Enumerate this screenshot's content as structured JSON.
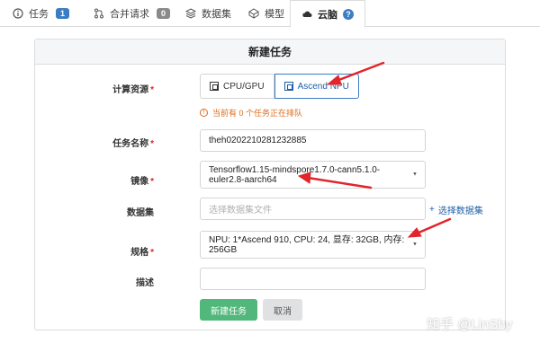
{
  "tabs": [
    {
      "label": "任务",
      "badge": "1",
      "icon": "info-icon"
    },
    {
      "label": "合并请求",
      "badge": "0",
      "icon": "merge-icon"
    },
    {
      "label": "数据集",
      "icon": "dataset-icon"
    },
    {
      "label": "模型",
      "icon": "model-icon"
    },
    {
      "label": "云脑",
      "icon": "cloud-brain-icon",
      "help": "?"
    }
  ],
  "form": {
    "title": "新建任务",
    "resource_label": "计算资源",
    "resource_options": [
      "CPU/GPU",
      "Ascend NPU"
    ],
    "resource_selected": "Ascend NPU",
    "queue_notice": "当前有 0 个任务正在排队",
    "task_name_label": "任务名称",
    "task_name_value": "theh0202210281232885",
    "image_label": "镜像",
    "image_value": "Tensorflow1.15-mindspore1.7.0-cann5.1.0-euler2.8-aarch64",
    "dataset_label": "数据集",
    "dataset_placeholder": "选择数据集文件",
    "choose_dataset": "选择数据集",
    "spec_label": "规格",
    "spec_value": "NPU: 1*Ascend 910, CPU: 24, 显存: 32GB, 内存: 256GB",
    "desc_label": "描述",
    "desc_value": "",
    "submit_label": "新建任务",
    "cancel_label": "取消"
  },
  "watermark": "知乎 @LinShy",
  "colors": {
    "accent": "#3b7dc4",
    "primary_button": "#52b77a",
    "warning": "#e06c1a",
    "required": "#db2828",
    "arrow": "#e0262a"
  }
}
